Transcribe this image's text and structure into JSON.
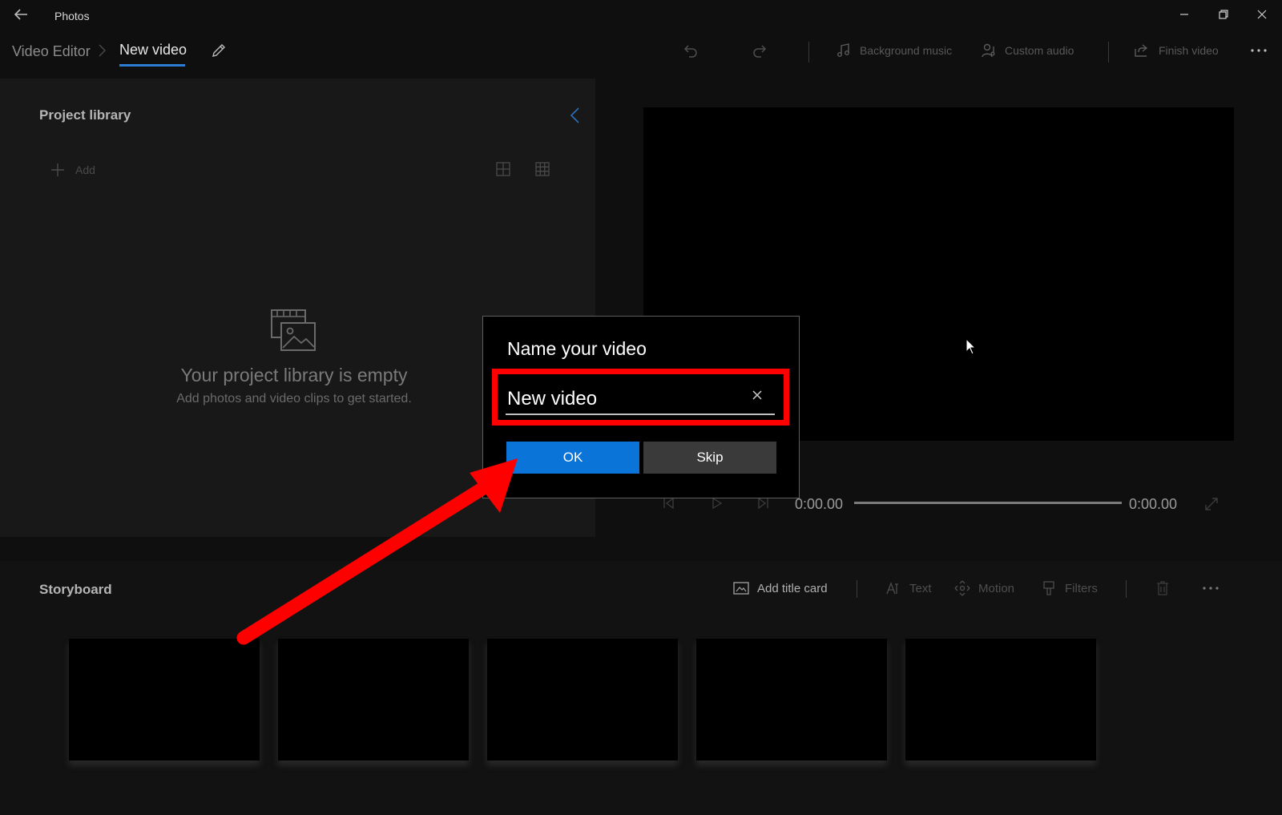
{
  "titlebar": {
    "app_title": "Photos",
    "back_icon": "back-arrow-icon",
    "window_controls": [
      "minimize-icon",
      "restore-icon",
      "close-icon"
    ]
  },
  "toolbar": {
    "breadcrumb_root": "Video Editor",
    "breadcrumb_current": "New video",
    "undo_icon": "undo-icon",
    "redo_icon": "redo-icon",
    "background_music": "Background music",
    "custom_audio": "Custom audio",
    "finish_video": "Finish video",
    "more_icon": "more-icon"
  },
  "library": {
    "title": "Project library",
    "add_label": "Add",
    "empty_title": "Your project library is empty",
    "empty_subtitle": "Add photos and video clips to get started."
  },
  "playback": {
    "current_time": "0:00.00",
    "total_time": "0:00.00",
    "progress": 0
  },
  "storyboard": {
    "title": "Storyboard",
    "add_title_card": "Add title card",
    "text": "Text",
    "motion": "Motion",
    "filters": "Filters",
    "slot_count": 5
  },
  "dialog": {
    "title": "Name your video",
    "input_value": "New video",
    "ok_label": "OK",
    "skip_label": "Skip"
  },
  "colors": {
    "accent": "#0a74d8",
    "highlight": "#ff0000",
    "annotation_arrow": "#ff0000"
  }
}
